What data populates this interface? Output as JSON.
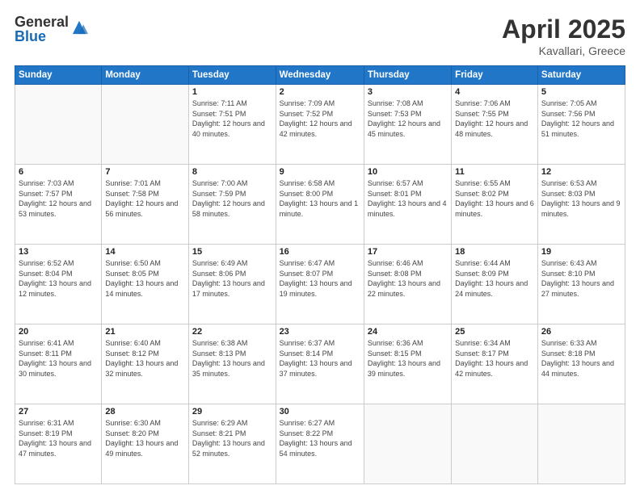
{
  "logo": {
    "general": "General",
    "blue": "Blue"
  },
  "title": "April 2025",
  "subtitle": "Kavallari, Greece",
  "header_days": [
    "Sunday",
    "Monday",
    "Tuesday",
    "Wednesday",
    "Thursday",
    "Friday",
    "Saturday"
  ],
  "weeks": [
    [
      {
        "day": "",
        "info": ""
      },
      {
        "day": "",
        "info": ""
      },
      {
        "day": "1",
        "info": "Sunrise: 7:11 AM\nSunset: 7:51 PM\nDaylight: 12 hours and 40 minutes."
      },
      {
        "day": "2",
        "info": "Sunrise: 7:09 AM\nSunset: 7:52 PM\nDaylight: 12 hours and 42 minutes."
      },
      {
        "day": "3",
        "info": "Sunrise: 7:08 AM\nSunset: 7:53 PM\nDaylight: 12 hours and 45 minutes."
      },
      {
        "day": "4",
        "info": "Sunrise: 7:06 AM\nSunset: 7:55 PM\nDaylight: 12 hours and 48 minutes."
      },
      {
        "day": "5",
        "info": "Sunrise: 7:05 AM\nSunset: 7:56 PM\nDaylight: 12 hours and 51 minutes."
      }
    ],
    [
      {
        "day": "6",
        "info": "Sunrise: 7:03 AM\nSunset: 7:57 PM\nDaylight: 12 hours and 53 minutes."
      },
      {
        "day": "7",
        "info": "Sunrise: 7:01 AM\nSunset: 7:58 PM\nDaylight: 12 hours and 56 minutes."
      },
      {
        "day": "8",
        "info": "Sunrise: 7:00 AM\nSunset: 7:59 PM\nDaylight: 12 hours and 58 minutes."
      },
      {
        "day": "9",
        "info": "Sunrise: 6:58 AM\nSunset: 8:00 PM\nDaylight: 13 hours and 1 minute."
      },
      {
        "day": "10",
        "info": "Sunrise: 6:57 AM\nSunset: 8:01 PM\nDaylight: 13 hours and 4 minutes."
      },
      {
        "day": "11",
        "info": "Sunrise: 6:55 AM\nSunset: 8:02 PM\nDaylight: 13 hours and 6 minutes."
      },
      {
        "day": "12",
        "info": "Sunrise: 6:53 AM\nSunset: 8:03 PM\nDaylight: 13 hours and 9 minutes."
      }
    ],
    [
      {
        "day": "13",
        "info": "Sunrise: 6:52 AM\nSunset: 8:04 PM\nDaylight: 13 hours and 12 minutes."
      },
      {
        "day": "14",
        "info": "Sunrise: 6:50 AM\nSunset: 8:05 PM\nDaylight: 13 hours and 14 minutes."
      },
      {
        "day": "15",
        "info": "Sunrise: 6:49 AM\nSunset: 8:06 PM\nDaylight: 13 hours and 17 minutes."
      },
      {
        "day": "16",
        "info": "Sunrise: 6:47 AM\nSunset: 8:07 PM\nDaylight: 13 hours and 19 minutes."
      },
      {
        "day": "17",
        "info": "Sunrise: 6:46 AM\nSunset: 8:08 PM\nDaylight: 13 hours and 22 minutes."
      },
      {
        "day": "18",
        "info": "Sunrise: 6:44 AM\nSunset: 8:09 PM\nDaylight: 13 hours and 24 minutes."
      },
      {
        "day": "19",
        "info": "Sunrise: 6:43 AM\nSunset: 8:10 PM\nDaylight: 13 hours and 27 minutes."
      }
    ],
    [
      {
        "day": "20",
        "info": "Sunrise: 6:41 AM\nSunset: 8:11 PM\nDaylight: 13 hours and 30 minutes."
      },
      {
        "day": "21",
        "info": "Sunrise: 6:40 AM\nSunset: 8:12 PM\nDaylight: 13 hours and 32 minutes."
      },
      {
        "day": "22",
        "info": "Sunrise: 6:38 AM\nSunset: 8:13 PM\nDaylight: 13 hours and 35 minutes."
      },
      {
        "day": "23",
        "info": "Sunrise: 6:37 AM\nSunset: 8:14 PM\nDaylight: 13 hours and 37 minutes."
      },
      {
        "day": "24",
        "info": "Sunrise: 6:36 AM\nSunset: 8:15 PM\nDaylight: 13 hours and 39 minutes."
      },
      {
        "day": "25",
        "info": "Sunrise: 6:34 AM\nSunset: 8:17 PM\nDaylight: 13 hours and 42 minutes."
      },
      {
        "day": "26",
        "info": "Sunrise: 6:33 AM\nSunset: 8:18 PM\nDaylight: 13 hours and 44 minutes."
      }
    ],
    [
      {
        "day": "27",
        "info": "Sunrise: 6:31 AM\nSunset: 8:19 PM\nDaylight: 13 hours and 47 minutes."
      },
      {
        "day": "28",
        "info": "Sunrise: 6:30 AM\nSunset: 8:20 PM\nDaylight: 13 hours and 49 minutes."
      },
      {
        "day": "29",
        "info": "Sunrise: 6:29 AM\nSunset: 8:21 PM\nDaylight: 13 hours and 52 minutes."
      },
      {
        "day": "30",
        "info": "Sunrise: 6:27 AM\nSunset: 8:22 PM\nDaylight: 13 hours and 54 minutes."
      },
      {
        "day": "",
        "info": ""
      },
      {
        "day": "",
        "info": ""
      },
      {
        "day": "",
        "info": ""
      }
    ]
  ]
}
